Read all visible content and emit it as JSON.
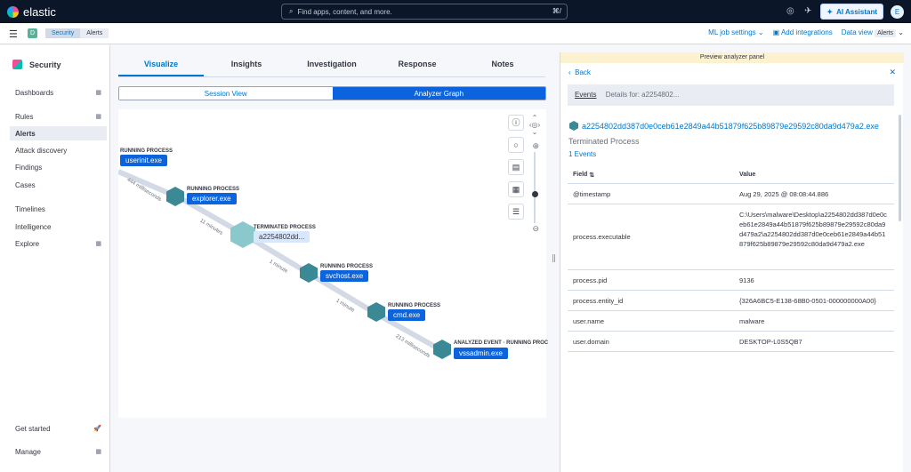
{
  "app": {
    "name": "elastic"
  },
  "search": {
    "placeholder": "Find apps, content, and more.",
    "shortcut": "⌘/"
  },
  "top": {
    "ai_label": "AI Assistant",
    "avatar": "E"
  },
  "nav": {
    "space": "D",
    "breadcrumbs": [
      "Security",
      "Alerts"
    ],
    "ml": "ML job settings",
    "integrations": "Add integrations",
    "dataview": "Data view",
    "dataview_badge": "Alerts"
  },
  "sidebar": {
    "title": "Security",
    "items": [
      {
        "label": "Dashboards",
        "grid": true
      },
      {
        "label": "Rules",
        "grid": true
      },
      {
        "label": "Alerts",
        "active": true
      },
      {
        "label": "Attack discovery"
      },
      {
        "label": "Findings"
      },
      {
        "label": "Cases"
      },
      {
        "label": "Timelines"
      },
      {
        "label": "Intelligence"
      },
      {
        "label": "Explore",
        "grid": true
      }
    ],
    "get_started": "Get started",
    "manage": "Manage"
  },
  "tabs": [
    "Visualize",
    "Insights",
    "Investigation",
    "Response",
    "Notes"
  ],
  "toggle": [
    "Session View",
    "Analyzer Graph"
  ],
  "graph": {
    "nodes": [
      {
        "label": "RUNNING PROCESS",
        "name": "userinit.exe"
      },
      {
        "label": "RUNNING PROCESS",
        "name": "explorer.exe"
      },
      {
        "label": "TERMINATED PROCESS",
        "name": "a2254802dd..."
      },
      {
        "label": "RUNNING PROCESS",
        "name": "svchost.exe"
      },
      {
        "label": "RUNNING PROCESS",
        "name": "cmd.exe"
      },
      {
        "label": "ANALYZED EVENT · RUNNING PROC",
        "name": "vssadmin.exe"
      }
    ],
    "edges": [
      "444 milliseconds",
      "11 minutes",
      "1 minute",
      "1 minute",
      "213 milliseconds"
    ]
  },
  "panel": {
    "preview": "Preview analyzer panel",
    "back": "Back",
    "events": "Events",
    "details": "Details for: a2254802...",
    "hash": "a2254802dd387d0e0ceb61e2849a44b51879f625b89879e29592c80da9d479a2.exe",
    "status": "Terminated Process",
    "count": "1 Events",
    "col_field": "Field",
    "col_value": "Value",
    "rows": [
      {
        "f": "@timestamp",
        "v": "Aug 29, 2025 @ 08:08:44.886"
      },
      {
        "f": "process.executable",
        "v": "C:\\Users\\malware\\Desktop\\a2254802dd387d0e0ceb61e2849a44b51879f625b89879e29592c80da9d479a2\\a2254802dd387d0e0ceb61e2849a44b51879f625b89879e29592c80da9d479a2.exe"
      },
      {
        "f": "process.pid",
        "v": "9136"
      },
      {
        "f": "process.entity_id",
        "v": "{326A6BC5-E138-68B0-0501-000000000A00}"
      },
      {
        "f": "user.name",
        "v": "malware"
      },
      {
        "f": "user.domain",
        "v": "DESKTOP-L0S5QB7"
      }
    ]
  }
}
